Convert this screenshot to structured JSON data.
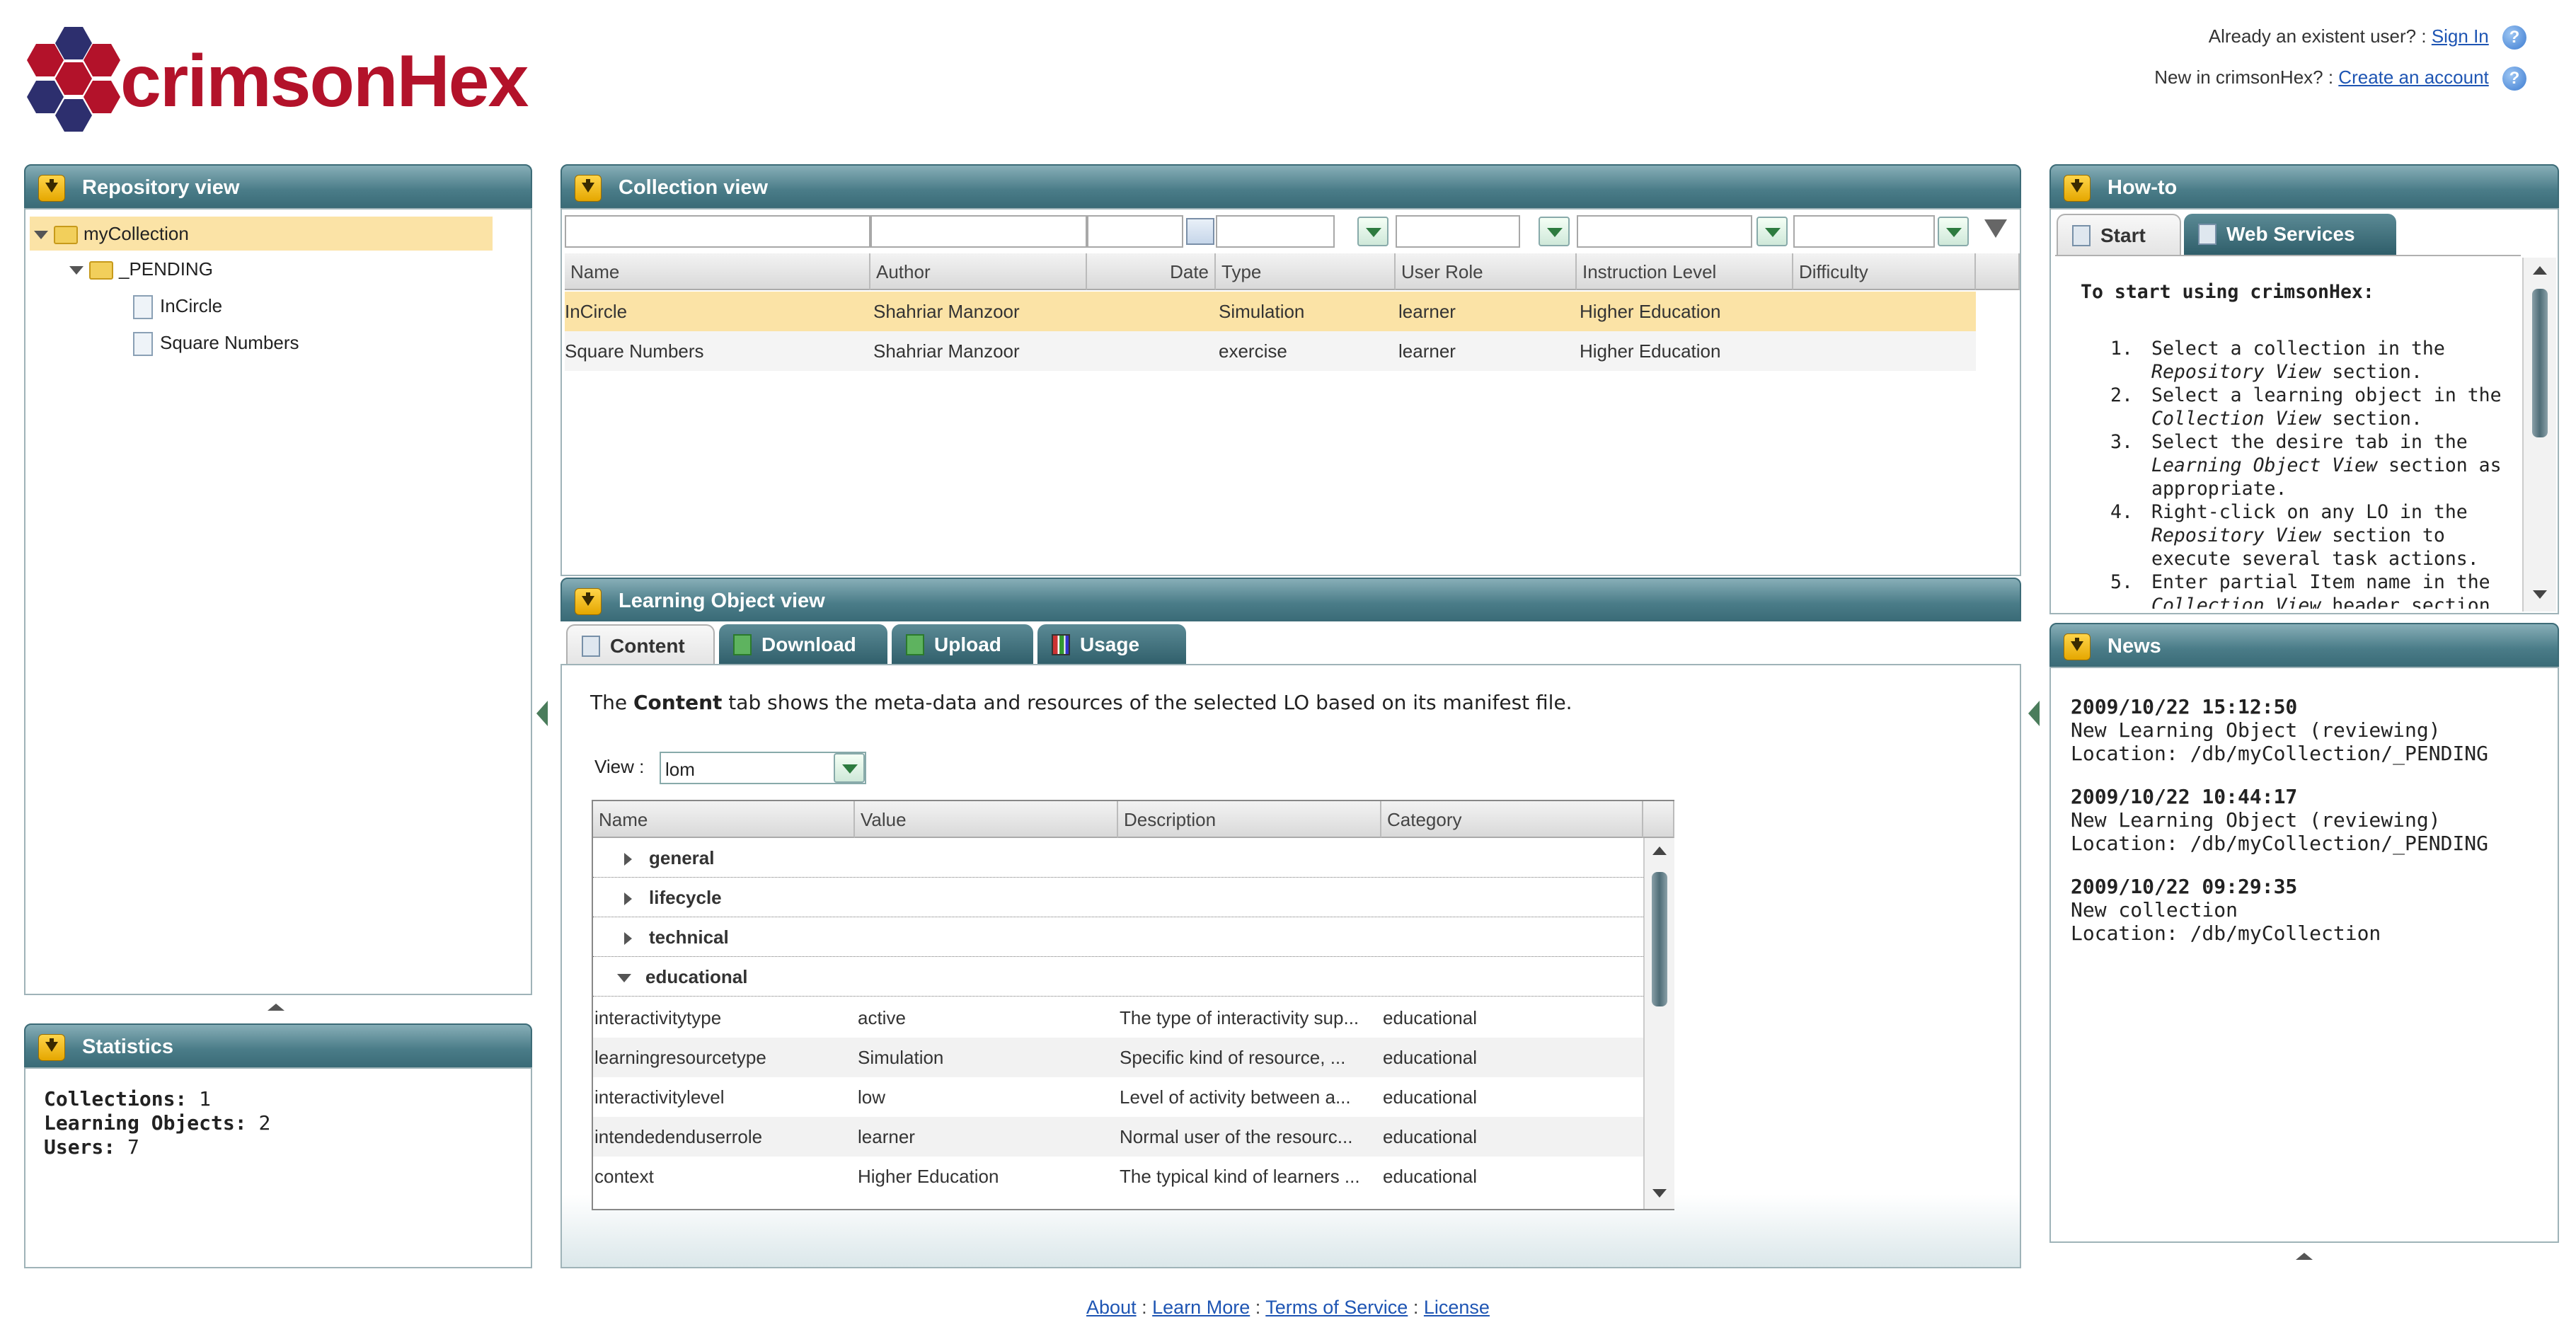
{
  "brand": {
    "name": "crimsonHex",
    "primary_color": "#b3122a",
    "secondary_color": "#2d2f6e"
  },
  "account": {
    "existing_prompt": "Already an existent user? :",
    "sign_in_label": "Sign In",
    "new_prompt": "New in crimsonHex? :",
    "create_label": "Create an account"
  },
  "repository": {
    "title": "Repository view",
    "tree": [
      {
        "label": "myCollection",
        "selected": true
      },
      {
        "label": "_PENDING"
      },
      {
        "label": "InCircle"
      },
      {
        "label": "Square Numbers"
      }
    ]
  },
  "statistics": {
    "title": "Statistics",
    "collections_label": "Collections:",
    "collections_value": "1",
    "los_label": "Learning Objects:",
    "los_value": "2",
    "users_label": "Users:",
    "users_value": "7"
  },
  "collection": {
    "title": "Collection view",
    "columns": [
      "Name",
      "Author",
      "Date",
      "Type",
      "User Role",
      "Instruction Level",
      "Difficulty"
    ],
    "rows": [
      {
        "name": "InCircle",
        "author": "Shahriar Manzoor",
        "date": "",
        "type": "Simulation",
        "role": "learner",
        "level": "Higher Education",
        "difficulty": ""
      },
      {
        "name": "Square Numbers",
        "author": "Shahriar Manzoor",
        "date": "",
        "type": "exercise",
        "role": "learner",
        "level": "Higher Education",
        "difficulty": ""
      }
    ]
  },
  "lo_view": {
    "title": "Learning Object view",
    "tabs": [
      "Content",
      "Download",
      "Upload",
      "Usage"
    ],
    "intro_pre": "The ",
    "intro_bold": "Content",
    "intro_post": " tab shows the meta-data and resources of the selected LO based on its manifest file.",
    "view_label": "View :",
    "view_value": "lom",
    "columns": [
      "Name",
      "Value",
      "Description",
      "Category"
    ],
    "groups": [
      {
        "label": "general",
        "expanded": false
      },
      {
        "label": "lifecycle",
        "expanded": false
      },
      {
        "label": "technical",
        "expanded": false
      },
      {
        "label": "educational",
        "expanded": true
      }
    ],
    "rows": [
      {
        "name": "interactivitytype",
        "value": "active",
        "description": "The type of interactivity sup...",
        "category": "educational"
      },
      {
        "name": "learningresourcetype",
        "value": "Simulation",
        "description": "Specific kind of resource, ...",
        "category": "educational"
      },
      {
        "name": "interactivitylevel",
        "value": "low",
        "description": "Level of activity between a...",
        "category": "educational"
      },
      {
        "name": "intendedenduserrole",
        "value": "learner",
        "description": "Normal user of the resourc...",
        "category": "educational"
      },
      {
        "name": "context",
        "value": "Higher Education",
        "description": "The typical kind of learners ...",
        "category": "educational"
      }
    ]
  },
  "howto": {
    "title": "How-to",
    "tabs": [
      "Start",
      "Web Services"
    ],
    "heading": "To start using crimsonHex:",
    "steps": [
      {
        "num": "1.",
        "a": "Select a collection in the",
        "b_em": "Repository View",
        "b_rest": " section."
      },
      {
        "num": "2.",
        "a": "Select a learning object in the",
        "b_em": "Collection View",
        "b_rest": " section."
      },
      {
        "num": "3.",
        "a": "Select the desire tab in the",
        "b_em": "Learning Object View",
        "b_rest": " section as",
        "c": "appropriate."
      },
      {
        "num": "4.",
        "a": "Right-click on any LO in the",
        "b_em": "Repository View",
        "b_rest": " section to",
        "c": "execute several task actions."
      },
      {
        "num": "5.",
        "a": "Enter partial Item name in the",
        "b_em": "Collection View",
        "b_rest": " header section to"
      }
    ]
  },
  "news": {
    "title": "News",
    "items": [
      {
        "date": "2009/10/22 15:12:50",
        "line1": "New Learning Object (reviewing)",
        "line2": "Location: /db/myCollection/_PENDING"
      },
      {
        "date": "2009/10/22 10:44:17",
        "line1": "New Learning Object (reviewing)",
        "line2": "Location: /db/myCollection/_PENDING"
      },
      {
        "date": "2009/10/22 09:29:35",
        "line1": "New collection",
        "line2": "Location: /db/myCollection"
      }
    ]
  },
  "footer": {
    "links": [
      "About",
      "Learn More",
      "Terms of Service",
      "License"
    ],
    "separator": ":"
  }
}
